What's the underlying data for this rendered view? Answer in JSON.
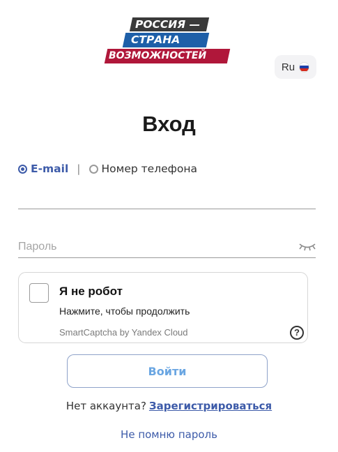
{
  "logo": {
    "line1": "РОССИЯ —",
    "line2": "СТРАНА",
    "line3": "ВОЗМОЖНОСТЕЙ",
    "colors": {
      "line1": "#3a3a3a",
      "line2": "#1e5fa8",
      "line3": "#b0173a"
    }
  },
  "language": {
    "label": "Ru",
    "flag_icon": "russia-flag-icon"
  },
  "title": "Вход",
  "login_tabs": [
    {
      "label": "E-mail",
      "selected": true
    },
    {
      "label": "Номер телефона",
      "selected": false
    }
  ],
  "tab_separator": "|",
  "email_field": {
    "value": "",
    "placeholder": ""
  },
  "password_field": {
    "value": "",
    "placeholder": "Пароль",
    "toggle_icon": "eye-closed-icon"
  },
  "captcha": {
    "title": "Я не робот",
    "subtitle": "Нажмите, чтобы продолжить",
    "brand": "SmartCaptcha by Yandex Cloud",
    "help_label": "?"
  },
  "login_button": "Войти",
  "register": {
    "prompt": "Нет аккаунта?",
    "link": "Зарегистрироваться"
  },
  "forgot_password": "Не помню пароль",
  "colors": {
    "accent": "#3d5ba9",
    "button_text": "#6aa6e2"
  }
}
